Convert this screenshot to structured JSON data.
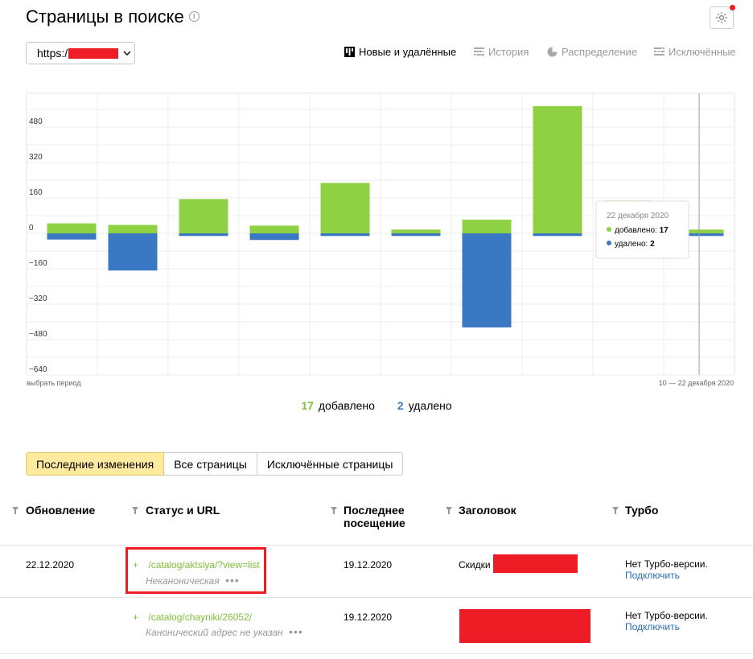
{
  "header": {
    "title": "Страницы в поиске",
    "host_prefix": "https:/"
  },
  "view_tabs": [
    {
      "label": "Новые и удалённые",
      "icon": "bar-chart-icon",
      "active": true
    },
    {
      "label": "История",
      "icon": "history-icon",
      "active": false
    },
    {
      "label": "Распределение",
      "icon": "pie-chart-icon",
      "active": false
    },
    {
      "label": "Исключённые",
      "icon": "excluded-icon",
      "active": false
    }
  ],
  "chart": {
    "left_caption": "выбрать период",
    "right_caption": "10 — 22 декабря 2020"
  },
  "chart_data": {
    "type": "bar",
    "stacked": true,
    "categories": [
      "",
      "",
      "",
      "",
      "",
      "",
      "",
      "",
      "",
      ""
    ],
    "series": [
      {
        "name": "добавлено",
        "color": "#8ed244",
        "values": [
          45,
          38,
          155,
          35,
          228,
          17,
          62,
          575,
          148,
          17
        ]
      },
      {
        "name": "удалено",
        "color": "#3a78c3",
        "values": [
          -28,
          -168,
          -12,
          -30,
          -12,
          -12,
          -425,
          -12,
          0,
          -12
        ]
      }
    ],
    "yticks": [
      480,
      320,
      160,
      0,
      -160,
      -320,
      -480,
      -640
    ],
    "ylim": [
      -640,
      640
    ],
    "grid": true,
    "tooltip": {
      "date": "22 декабря 2020",
      "added_label": "добавлено:",
      "added_value": "17",
      "removed_label": "удалено:",
      "removed_value": "2"
    }
  },
  "summary": {
    "added_count": "17",
    "added_label": "добавлено",
    "removed_count": "2",
    "removed_label": "удалено"
  },
  "segment_tabs": [
    {
      "label": "Последние изменения",
      "active": true
    },
    {
      "label": "Все страницы",
      "active": false
    },
    {
      "label": "Исключённые страницы",
      "active": false
    }
  ],
  "table": {
    "columns": {
      "updated": "Обновление",
      "status": "Статус и URL",
      "last_visit_1": "Последнее",
      "last_visit_2": "посещение",
      "heading": "Заголовок",
      "turbo": "Турбо"
    },
    "rows": [
      {
        "date": "22.12.2020",
        "url": "/catalog/aktsiya/?view=list",
        "status": "Неканоническая",
        "visit": "19.12.2020",
        "heading": "Скидки",
        "turbo_text": "Нет Турбо-версии.",
        "turbo_link": "Подключить"
      },
      {
        "date": "",
        "url": "/catalog/chayniki/26052/",
        "status": "Канонический адрес не указан",
        "visit": "19.12.2020",
        "heading": "",
        "turbo_text": "Нет Турбо-версии.",
        "turbo_link": "Подключить"
      }
    ]
  }
}
